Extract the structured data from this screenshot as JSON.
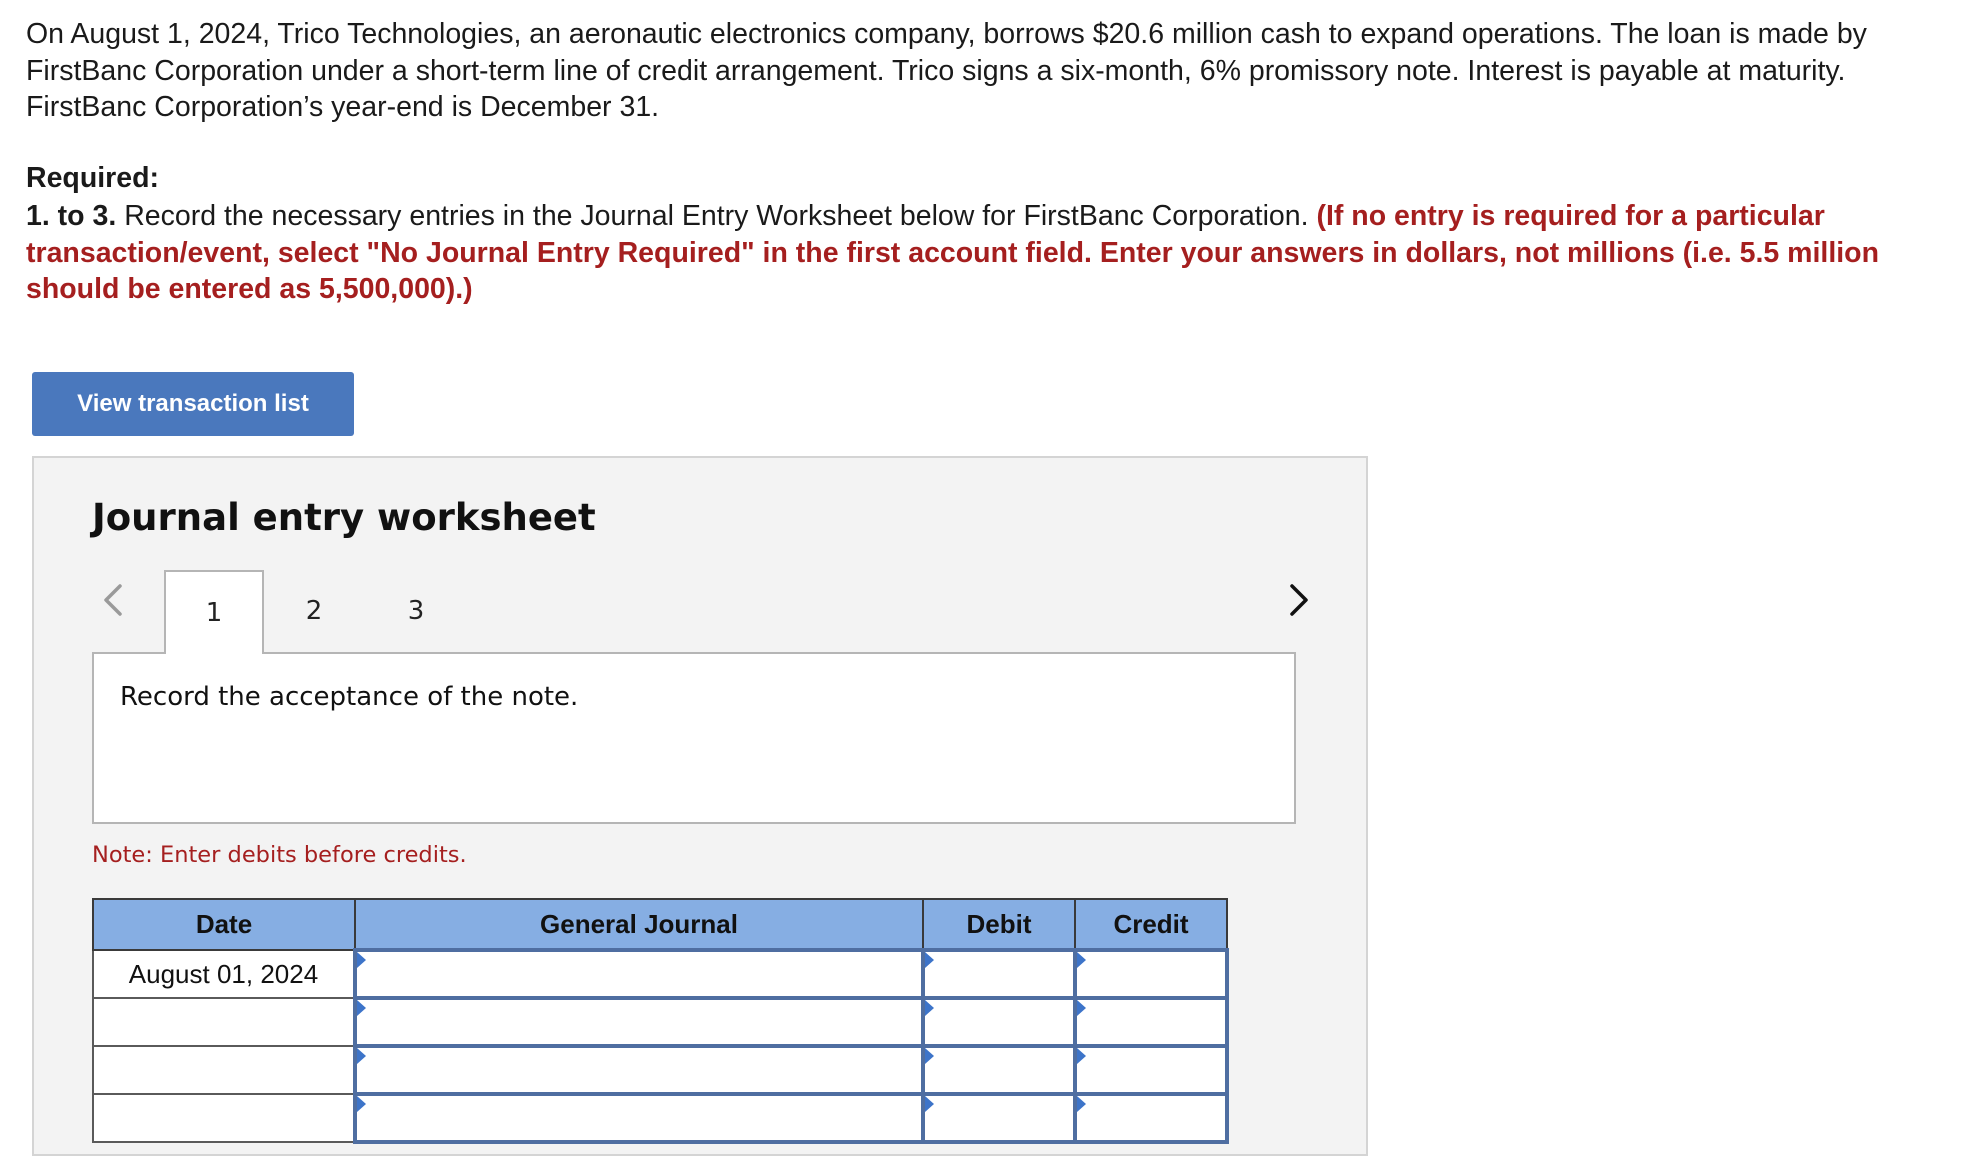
{
  "problem": {
    "text": "On August 1, 2024, Trico Technologies, an aeronautic electronics company, borrows $20.6 million cash to expand operations. The loan is made by FirstBanc Corporation under a short-term line of credit arrangement. Trico signs a six-month, 6% promissory note. Interest is payable at maturity. FirstBanc Corporation’s year-end is December 31."
  },
  "required": {
    "heading": "Required:",
    "number": "1. to 3.",
    "instruction": " Record the necessary entries in the Journal Entry Worksheet below for FirstBanc Corporation. ",
    "emphasis": "(If no entry is required for a particular transaction/event, select \"No Journal Entry Required\" in the first account field. Enter your answers in dollars, not millions (i.e. 5.5 million should be entered as 5,500,000).)"
  },
  "view_button": {
    "label": "View transaction list"
  },
  "worksheet": {
    "title": "Journal entry worksheet",
    "tabs": [
      {
        "label": "1",
        "active": true
      },
      {
        "label": "2",
        "active": false
      },
      {
        "label": "3",
        "active": false
      }
    ],
    "prompt": "Record the acceptance of the note.",
    "note": "Note: Enter debits before credits.",
    "table": {
      "headers": [
        "Date",
        "General Journal",
        "Debit",
        "Credit"
      ],
      "rows": [
        {
          "date": "August 01, 2024",
          "account": "",
          "debit": "",
          "credit": ""
        },
        {
          "date": "",
          "account": "",
          "debit": "",
          "credit": ""
        },
        {
          "date": "",
          "account": "",
          "debit": "",
          "credit": ""
        },
        {
          "date": "",
          "account": "",
          "debit": "",
          "credit": ""
        }
      ]
    }
  },
  "colors": {
    "accent_button": "#4a78bd",
    "header_fill": "#86aee3",
    "instruction_red": "#a51f1f",
    "input_border": "#4f6ea1"
  },
  "icons": {
    "prev": "chevron-left-icon",
    "next": "chevron-right-icon",
    "dropdown_marker": "triangle-right-icon"
  }
}
